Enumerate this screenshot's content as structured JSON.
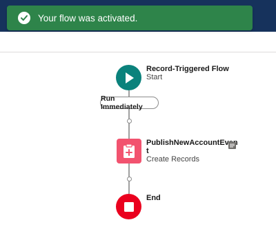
{
  "toast": {
    "message": "Your flow was activated.",
    "icon": "success-check-icon",
    "color": "#2e844a"
  },
  "flow": {
    "start": {
      "title": "Record-Triggered Flow",
      "subtitle": "Start",
      "icon": "play-icon",
      "color": "#0b827c"
    },
    "run_path": {
      "label": "Run Immediately"
    },
    "create_records": {
      "title_line1": "PublishNewAccountEven",
      "title_line2": "t",
      "subtitle": "Create Records",
      "icon": "create-records-icon",
      "color": "#f2536f"
    },
    "end": {
      "title": "End",
      "icon": "stop-icon",
      "color": "#ea001e"
    }
  },
  "colors": {
    "header": "#16325c",
    "connector": "#a0a0a0"
  }
}
